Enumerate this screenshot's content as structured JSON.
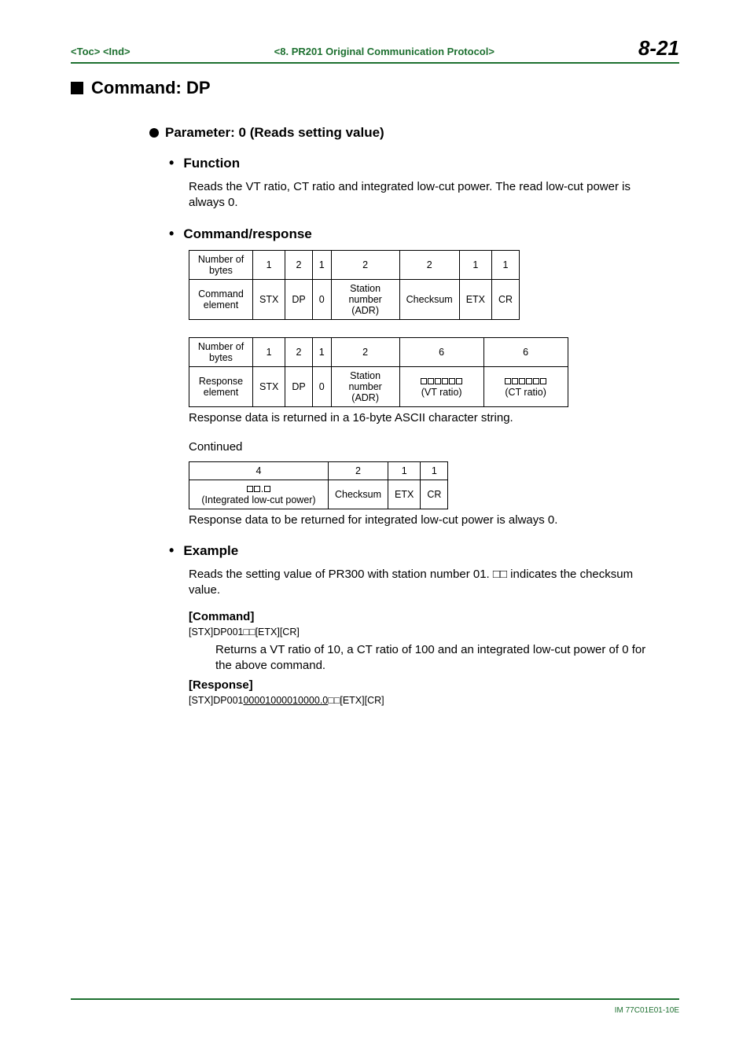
{
  "header": {
    "toc": "<Toc>",
    "ind": "<Ind>",
    "breadcrumb": "<8.  PR201 Original Communication Protocol>",
    "page_number": "8-21"
  },
  "command_title": "Command: DP",
  "parameter_title": "Parameter: 0 (Reads setting value)",
  "sections": {
    "function": {
      "heading": "Function",
      "text": "Reads the VT ratio, CT ratio and integrated low-cut power. The read low-cut power is always 0."
    },
    "cmd_resp": {
      "heading": "Command/response",
      "note1": "Response data is returned in a 16-byte ASCII character string.",
      "continued": "Continued",
      "note2": "Response data to be returned for integrated low-cut power is always 0."
    },
    "example": {
      "heading": "Example",
      "intro": "Reads the setting value of PR300 with station number 01. □□ indicates the checksum value.",
      "command_label": "[Command]",
      "command_line": "[STX]DP001□□[ETX][CR]",
      "returns": "Returns a VT ratio of 10, a CT ratio of 100 and an integrated low-cut power of 0 for the above command.",
      "response_label": "[Response]",
      "response_prefix": "[STX]DP001",
      "response_underlined": "000010000100",
      "response_under2": "00.0",
      "response_suffix": "□□[ETX][CR]"
    }
  },
  "tables": {
    "t1": {
      "r1": [
        "Number of bytes",
        "1",
        "2",
        "1",
        "2",
        "2",
        "1",
        "1"
      ],
      "r2": [
        "Command element",
        "STX",
        "DP",
        "0",
        "Station number (ADR)",
        "Checksum",
        "ETX",
        "CR"
      ]
    },
    "t2": {
      "r1": [
        "Number of bytes",
        "1",
        "2",
        "1",
        "2",
        "6",
        "6"
      ],
      "r2": [
        "Response element",
        "STX",
        "DP",
        "0",
        "Station number (ADR)",
        "(VT ratio)",
        "(CT ratio)"
      ]
    },
    "t3": {
      "r1": [
        "4",
        "2",
        "1",
        "1"
      ],
      "r2": [
        "(Integrated low-cut power)",
        "Checksum",
        "ETX",
        "CR"
      ]
    }
  },
  "footer": {
    "doc_id": "IM 77C01E01-10E"
  },
  "chart_data": {
    "type": "table",
    "title": "Command DP, Parameter 0 — byte layout",
    "command_bytes": {
      "Number_of_bytes": [
        1,
        2,
        1,
        2,
        2,
        1,
        1
      ],
      "Command_element": [
        "STX",
        "DP",
        "0",
        "Station number (ADR)",
        "Checksum",
        "ETX",
        "CR"
      ]
    },
    "response_bytes_part1": {
      "Number_of_bytes": [
        1,
        2,
        1,
        2,
        6,
        6
      ],
      "Response_element": [
        "STX",
        "DP",
        "0",
        "Station number (ADR)",
        "(VT ratio)",
        "(CT ratio)"
      ]
    },
    "response_bytes_part2": {
      "Number_of_bytes": [
        4,
        2,
        1,
        1
      ],
      "Response_element": [
        "(Integrated low-cut power)",
        "Checksum",
        "ETX",
        "CR"
      ]
    }
  }
}
